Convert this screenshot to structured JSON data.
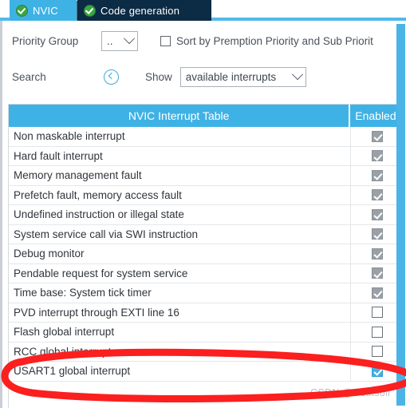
{
  "window": {
    "accent_blue": "#3fb2e5",
    "tab_inactive_bg": "#0c2b45",
    "checked_blue": "#3fb2e5",
    "locked_gray": "#9aa0a6",
    "annotation_color": "#fb1f1f"
  },
  "tabs": [
    {
      "label": "NVIC",
      "icon": "check-circle-icon",
      "active": true
    },
    {
      "label": "Code generation",
      "icon": "check-circle-icon",
      "active": false
    }
  ],
  "toolbar": {
    "priority_group_label": "Priority Group",
    "priority_group_value": "..",
    "sort_checkbox_label": "Sort by Premption Priority and Sub Priorit",
    "sort_checkbox_checked": false,
    "search_label": "Search",
    "search_icon": "circle-chevron-left-icon",
    "show_label": "Show",
    "show_value": "available interrupts"
  },
  "table": {
    "columns": [
      "NVIC Interrupt Table",
      "Enabled"
    ],
    "rows": [
      {
        "name": "Non maskable interrupt",
        "enabled": "locked"
      },
      {
        "name": "Hard fault interrupt",
        "enabled": "locked"
      },
      {
        "name": "Memory management fault",
        "enabled": "locked"
      },
      {
        "name": "Prefetch fault, memory access fault",
        "enabled": "locked"
      },
      {
        "name": "Undefined instruction or illegal state",
        "enabled": "locked"
      },
      {
        "name": "System service call via SWI instruction",
        "enabled": "locked"
      },
      {
        "name": "Debug monitor",
        "enabled": "locked"
      },
      {
        "name": "Pendable request for system service",
        "enabled": "locked"
      },
      {
        "name": "Time base: System tick timer",
        "enabled": "locked"
      },
      {
        "name": "PVD interrupt through EXTI line 16",
        "enabled": "empty"
      },
      {
        "name": "Flash global interrupt",
        "enabled": "empty"
      },
      {
        "name": "RCC global interrupt",
        "enabled": "empty"
      },
      {
        "name": "USART1 global interrupt",
        "enabled": "checked"
      }
    ]
  },
  "watermark": {
    "text": "CSDN @Costsoil"
  }
}
